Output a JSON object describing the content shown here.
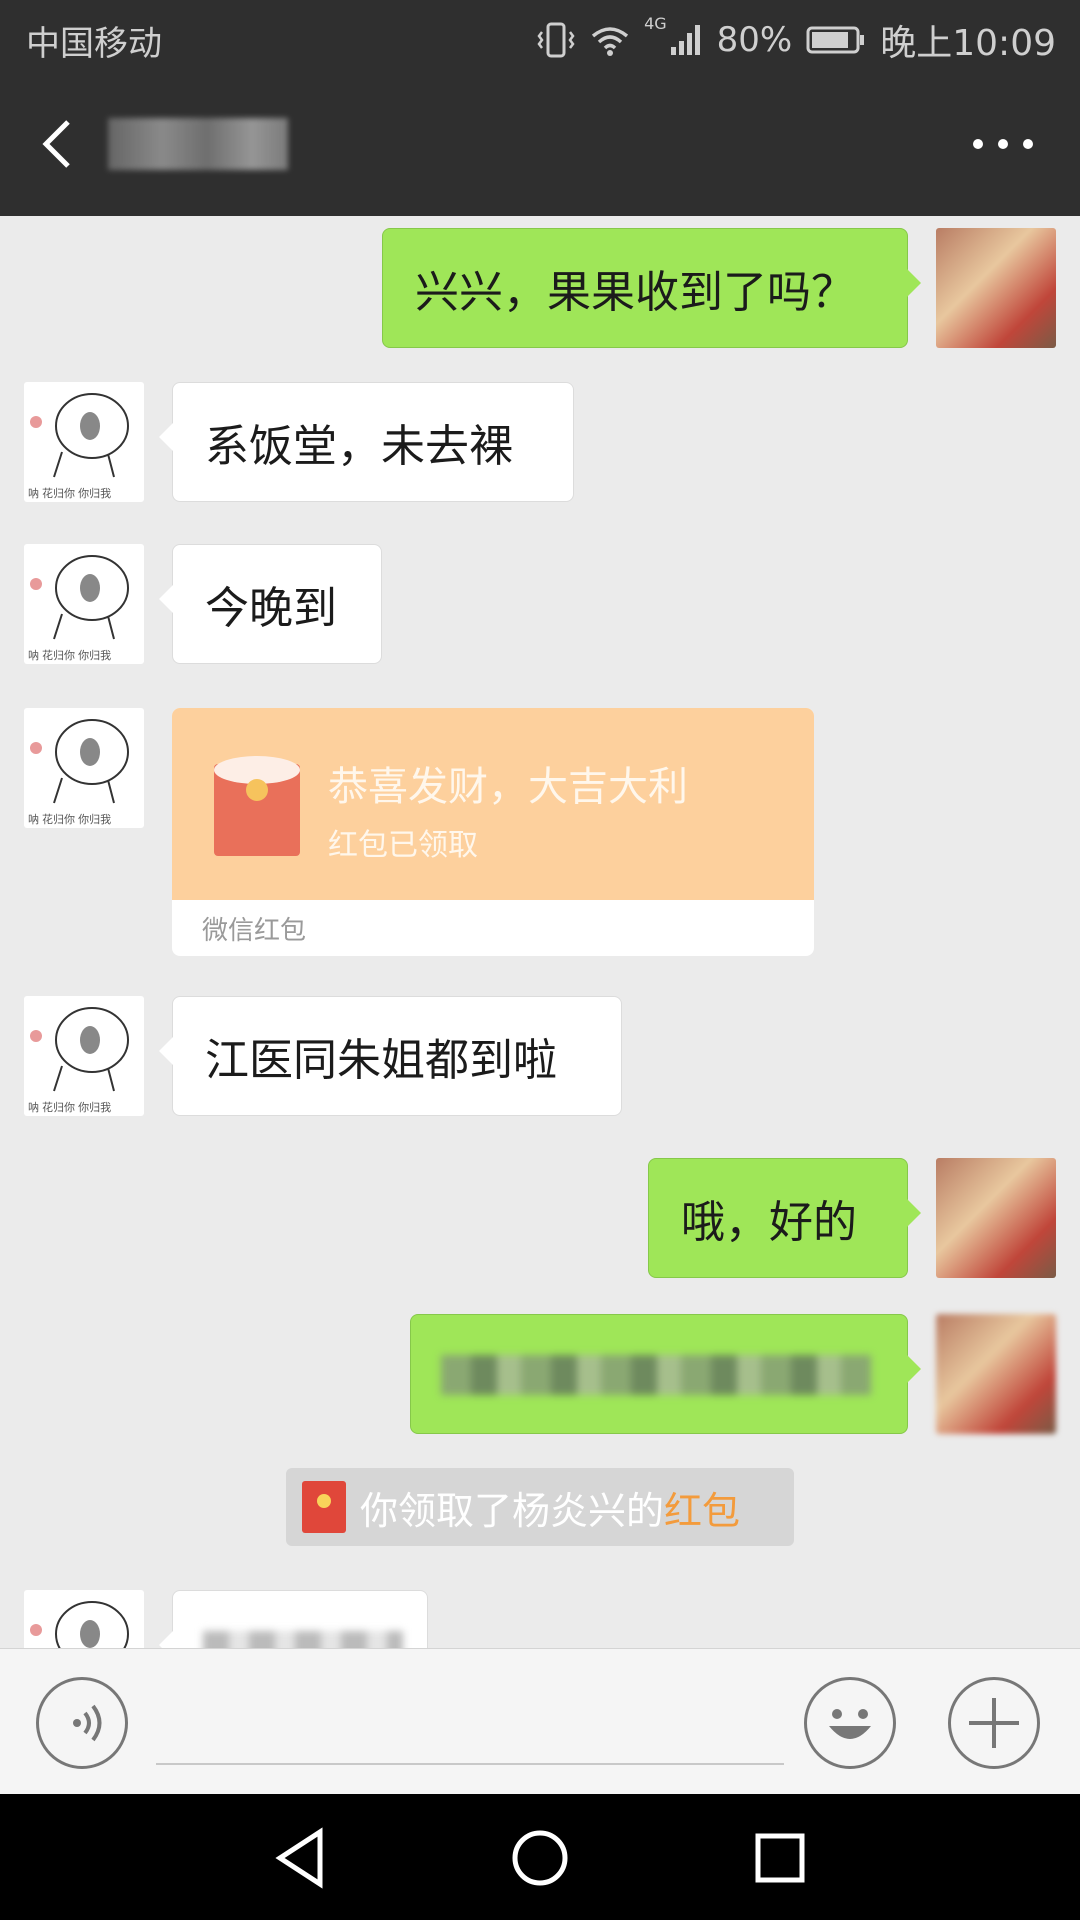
{
  "status_bar": {
    "carrier": "中国移动",
    "network": "4G",
    "battery": "80%",
    "time": "晚上10:09"
  },
  "header": {
    "back_icon": "back-arrow-icon",
    "more_icon": "more-dots-icon"
  },
  "messages": [
    {
      "side": "out",
      "text": "兴兴，果果收到了吗？"
    },
    {
      "side": "in",
      "text": "系饭堂，未去裸"
    },
    {
      "side": "in",
      "text": "今晚到"
    },
    {
      "side": "in",
      "type": "red_packet"
    },
    {
      "side": "in",
      "text": "江医同朱姐都到啦"
    },
    {
      "side": "out",
      "text": "哦，好的"
    },
    {
      "side": "out",
      "blurred": true
    },
    {
      "side": "system",
      "type": "notice"
    },
    {
      "side": "in",
      "blurred": true
    }
  ],
  "red_packet": {
    "title": "恭喜发财，大吉大利",
    "status": "红包已领取",
    "footer": "微信红包",
    "color": "#fdd09d"
  },
  "system_notice": {
    "text": "你领取了杨炎兴的",
    "link": "红包",
    "link_color": "#f39b3c"
  },
  "input_bar": {
    "voice_icon": "voice-icon",
    "emoji_icon": "emoji-icon",
    "plus_icon": "plus-icon",
    "placeholder": ""
  },
  "nav_bar": {
    "back": "nav-back-icon",
    "home": "nav-home-icon",
    "recent": "nav-recent-icon"
  },
  "colors": {
    "bubble_out": "#9fe658",
    "bubble_in": "#ffffff",
    "header_bg": "#2f2f2f",
    "chat_bg": "#ebebeb"
  }
}
